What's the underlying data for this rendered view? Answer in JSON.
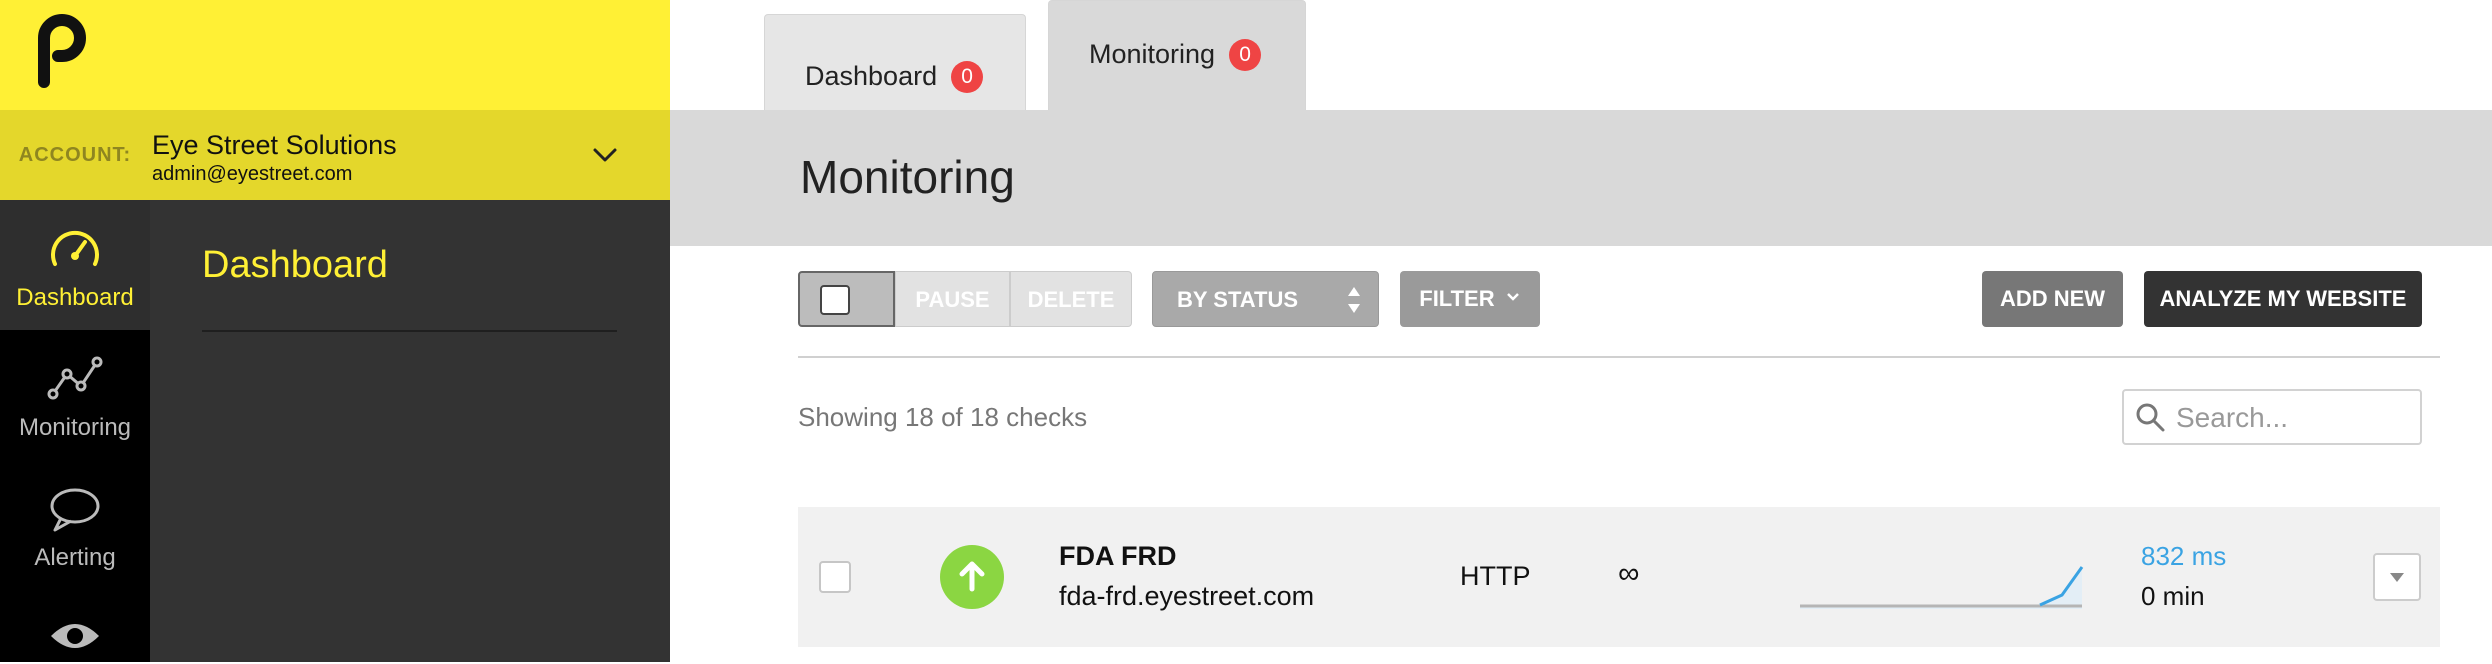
{
  "brand": {
    "logo_letter": "P",
    "accent_color": "#fff035"
  },
  "rail": [
    {
      "label": "Dashboard",
      "icon": "speedometer-icon",
      "active": true
    },
    {
      "label": "Monitoring",
      "icon": "line-graph-icon",
      "active": false
    },
    {
      "label": "Alerting",
      "icon": "speech-bubble-icon",
      "active": false
    },
    {
      "label": "",
      "icon": "eye-icon",
      "active": false
    }
  ],
  "account": {
    "key_label": "ACCOUNT:",
    "name": "Eye Street Solutions",
    "email": "admin@eyestreet.com"
  },
  "sidebar": {
    "title": "Dashboard"
  },
  "tabs": [
    {
      "label": "Dashboard",
      "count": "0",
      "active": false
    },
    {
      "label": "Monitoring",
      "count": "0",
      "active": true
    }
  ],
  "page": {
    "title": "Monitoring"
  },
  "toolbar": {
    "pause_label": "PAUSE",
    "delete_label": "DELETE",
    "status_label": "BY STATUS",
    "filter_label": "FILTER",
    "add_label": "ADD NEW",
    "analyze_label": "ANALYZE MY WEBSITE"
  },
  "summary": {
    "showing": "Showing 18 of 18 checks"
  },
  "search": {
    "placeholder": "Search..."
  },
  "checks": [
    {
      "name": "FDA FRD",
      "url": "fda-frd.eyestreet.com",
      "type": "HTTP",
      "interval": "∞",
      "response_time": "832 ms",
      "downtime": "0 min",
      "status": "up",
      "status_color": "#8bd642",
      "response_color": "#3aa3e3"
    }
  ]
}
